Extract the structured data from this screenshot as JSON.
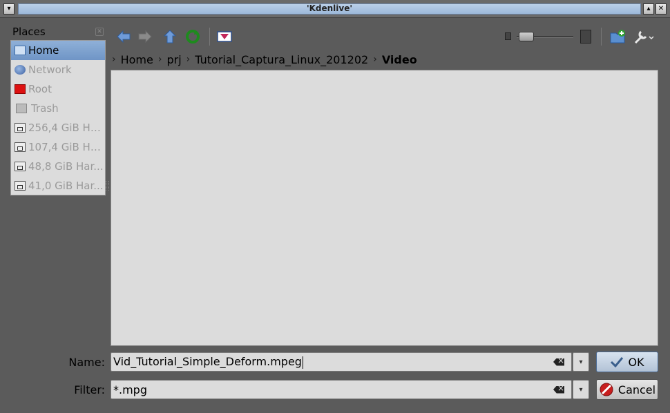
{
  "window": {
    "title": "'Kdenlive'",
    "menu_glyph": "▾",
    "minimize_glyph": "▴",
    "close_glyph": "✕"
  },
  "places": {
    "heading": "Places",
    "close_glyph": "✕",
    "items": [
      {
        "label": "Home",
        "icon": "home-folder-icon",
        "selected": true
      },
      {
        "label": "Network",
        "icon": "network-icon",
        "selected": false
      },
      {
        "label": "Root",
        "icon": "root-folder-icon",
        "selected": false
      },
      {
        "label": "Trash",
        "icon": "trash-icon",
        "selected": false
      },
      {
        "label": "256,4 GiB Ha...",
        "icon": "hard-disk-icon",
        "selected": false
      },
      {
        "label": "107,4 GiB Ha...",
        "icon": "hard-disk-icon",
        "selected": false
      },
      {
        "label": "48,8 GiB Har...",
        "icon": "hard-disk-icon",
        "selected": false
      },
      {
        "label": "41,0 GiB Har...",
        "icon": "hard-disk-icon",
        "selected": false
      }
    ]
  },
  "toolbar": {
    "icons": [
      "back-arrow-icon",
      "forward-arrow-icon",
      "up-arrow-icon",
      "reload-icon",
      "preview-icon",
      "zoom-slider",
      "new-folder-icon",
      "options-wrench-icon"
    ],
    "zoom_level": 0.05
  },
  "breadcrumb": {
    "separator": "›",
    "items": [
      "Home",
      "prj",
      "Tutorial_Captura_Linux_201202",
      "Video"
    ]
  },
  "name_row": {
    "label": "Name:",
    "value": "Vid_Tutorial_Simple_Deform.mpeg"
  },
  "filter_row": {
    "label": "Filter:",
    "value": "*.mpg"
  },
  "buttons": {
    "ok": "OK",
    "cancel": "Cancel"
  },
  "colors": {
    "background": "#5b5b5b",
    "panel": "#dcdcdc",
    "selection": "#7a9ccc",
    "title_bar": "#a9c3e3"
  }
}
